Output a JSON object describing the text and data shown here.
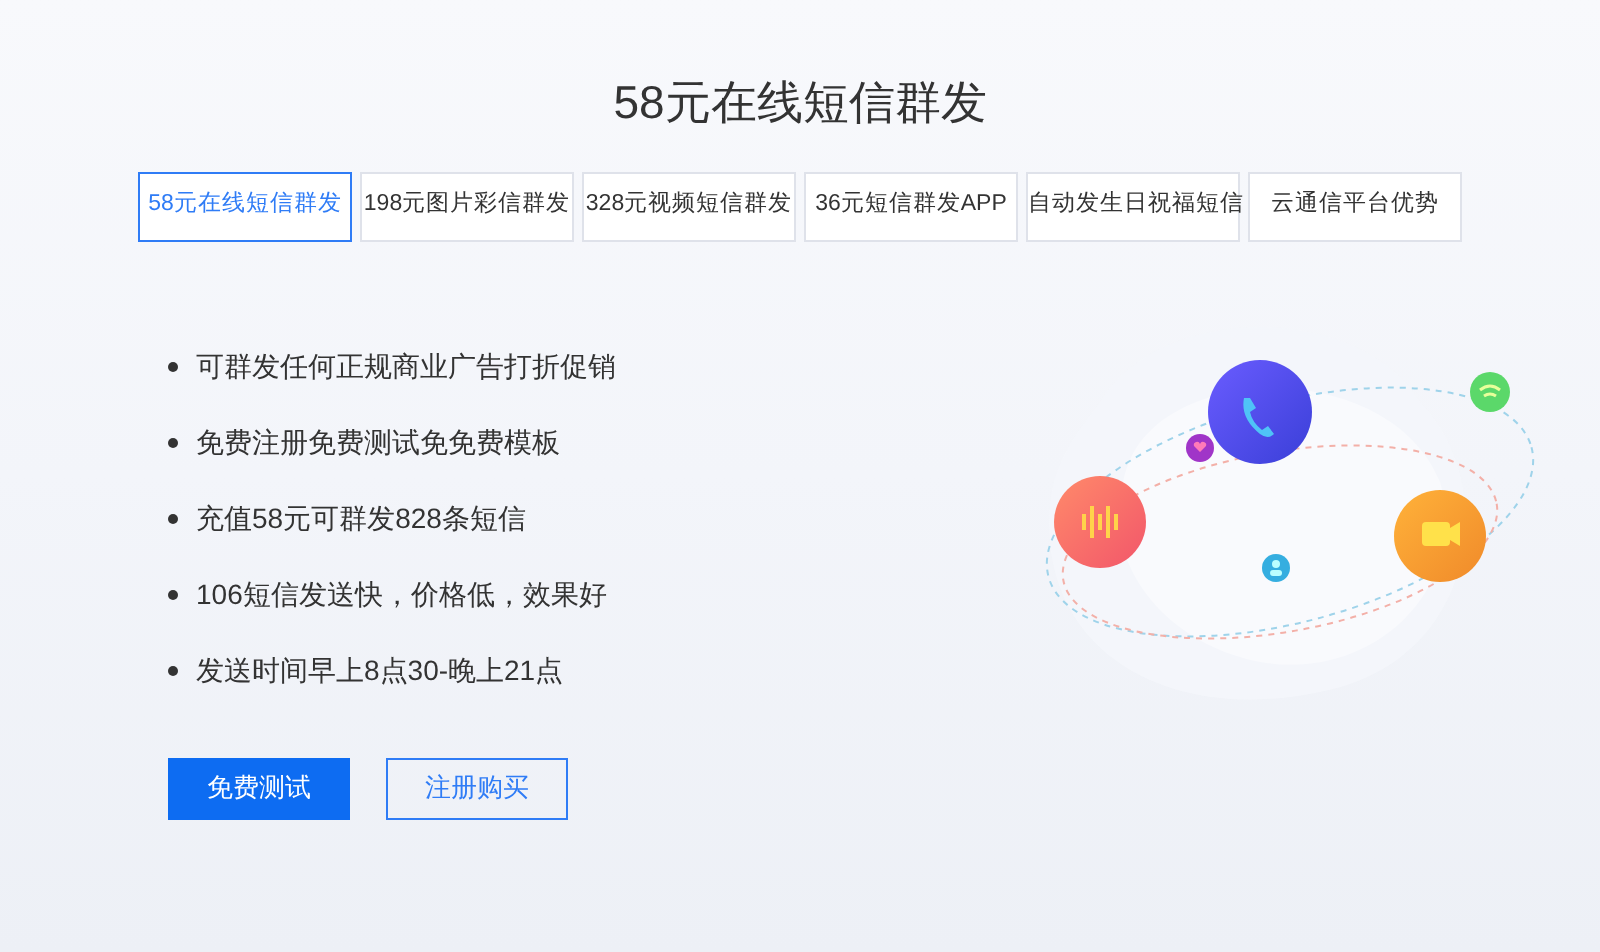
{
  "title": "58元在线短信群发",
  "tabs": [
    {
      "label": "58元在线短信群发",
      "selected": true
    },
    {
      "label": "198元图片彩信群发",
      "selected": false
    },
    {
      "label": "328元视频短信群发",
      "selected": false
    },
    {
      "label": "36元短信群发APP",
      "selected": false
    },
    {
      "label": "自动发生日祝福短信",
      "selected": false
    },
    {
      "label": "云通信平台优势",
      "selected": false
    }
  ],
  "features": [
    "可群发任何正规商业广告打折促销",
    "免费注册免费测试免免费模板",
    "充值58元可群发828条短信",
    "106短信发送快，价格低，效果好",
    "发送时间早上8点30-晚上21点"
  ],
  "buttons": [
    {
      "label": "免费测试",
      "kind": "primary"
    },
    {
      "label": "注册购买",
      "kind": "outline"
    }
  ]
}
